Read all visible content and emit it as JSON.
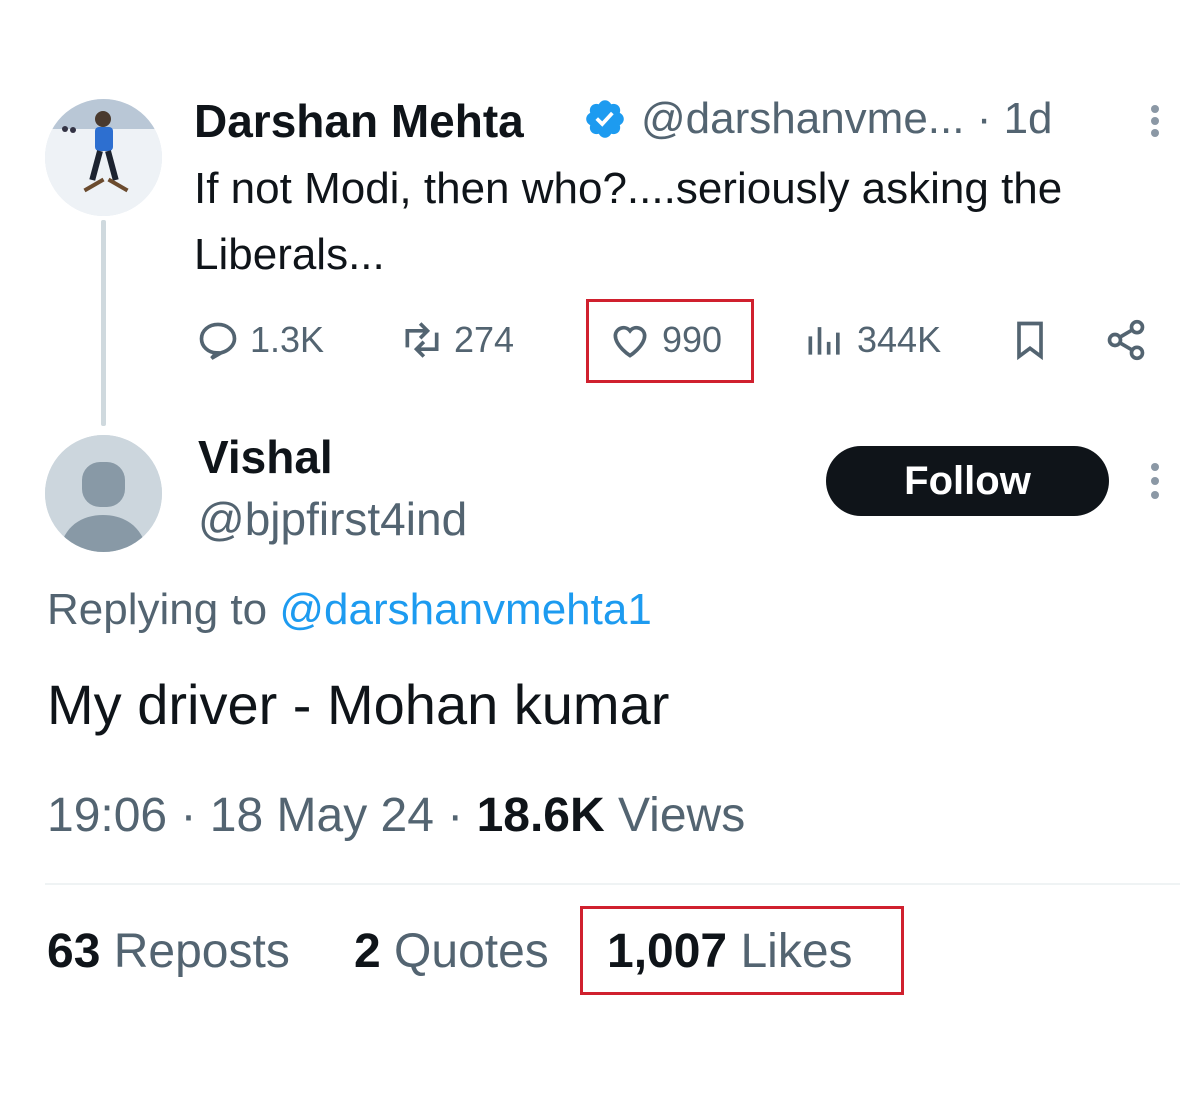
{
  "parent_tweet": {
    "author_name": "Darshan Mehta",
    "handle": "@darshanvme...",
    "time": "· 1d",
    "text": "If not Modi, then who?....seriously asking the Liberals...",
    "actions": {
      "replies": "1.3K",
      "reposts": "274",
      "likes": "990",
      "views": "344K"
    },
    "icons": [
      "verified-badge-icon",
      "more-icon",
      "reply-icon",
      "repost-icon",
      "like-icon",
      "views-icon",
      "bookmark-icon",
      "share-icon"
    ]
  },
  "reply_tweet": {
    "author_name": "Vishal",
    "handle": "@bjpfirst4ind",
    "follow_label": "Follow",
    "replying_prefix": "Replying to",
    "replying_handle": "@darshanvmehta1",
    "text": "My driver - Mohan kumar",
    "time": "19:06",
    "date": "18 May 24",
    "views_count": "18.6K",
    "views_label": "Views",
    "stats": {
      "reposts_count": "63",
      "reposts_label": "Reposts",
      "quotes_count": "2",
      "quotes_label": "Quotes",
      "likes_count": "1,007",
      "likes_label": "Likes"
    }
  },
  "colors": {
    "accent": "#1d9bf0",
    "muted_text": "#536471",
    "highlight_box": "#d0202e",
    "follow_button": "#0f1419"
  }
}
